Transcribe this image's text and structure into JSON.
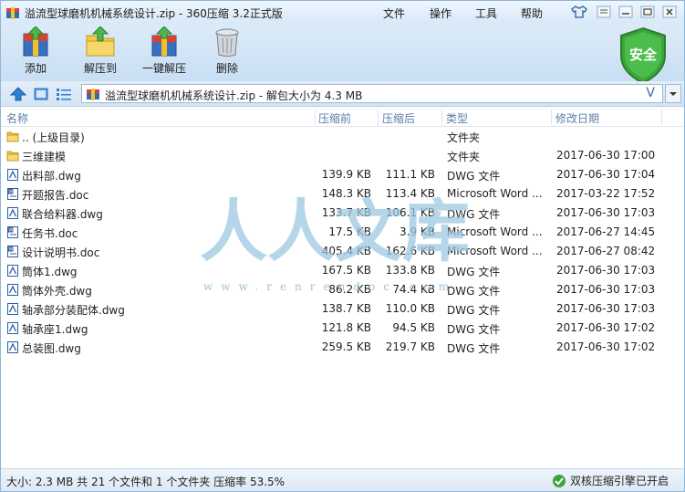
{
  "titlebar": {
    "title": "溢流型球磨机机械系统设计.zip - 360压缩 3.2正式版",
    "menus": [
      "文件",
      "操作",
      "工具",
      "帮助"
    ]
  },
  "toolbar": {
    "add_label": "添加",
    "extract_label": "解压到",
    "one_click_label": "一键解压",
    "delete_label": "删除",
    "shield_label": "安全"
  },
  "address": {
    "path": "溢流型球磨机机械系统设计.zip - 解包大小为 4.3 MB",
    "v_label": "V"
  },
  "columns": {
    "name": "名称",
    "pre": "压缩前",
    "post": "压缩后",
    "type": "类型",
    "date": "修改日期"
  },
  "files": [
    {
      "name": ".. (上级目录)",
      "pre": "",
      "post": "",
      "type": "文件夹",
      "date": "",
      "icon": "folder-icon"
    },
    {
      "name": "三维建模",
      "pre": "",
      "post": "",
      "type": "文件夹",
      "date": "2017-06-30 17:00",
      "icon": "folder-icon"
    },
    {
      "name": "出料部.dwg",
      "pre": "139.9 KB",
      "post": "111.1 KB",
      "type": "DWG 文件",
      "date": "2017-06-30 17:04",
      "icon": "dwg-icon"
    },
    {
      "name": "开题报告.doc",
      "pre": "148.3 KB",
      "post": "113.4 KB",
      "type": "Microsoft Word ...",
      "date": "2017-03-22 17:52",
      "icon": "doc-icon"
    },
    {
      "name": "联合给料器.dwg",
      "pre": "133.7 KB",
      "post": "106.1 KB",
      "type": "DWG 文件",
      "date": "2017-06-30 17:03",
      "icon": "dwg-icon"
    },
    {
      "name": "任务书.doc",
      "pre": "17.5 KB",
      "post": "3.9 KB",
      "type": "Microsoft Word ...",
      "date": "2017-06-27 14:45",
      "icon": "doc-icon"
    },
    {
      "name": "设计说明书.doc",
      "pre": "405.4 KB",
      "post": "162.6 KB",
      "type": "Microsoft Word ...",
      "date": "2017-06-27 08:42",
      "icon": "doc-icon"
    },
    {
      "name": "筒体1.dwg",
      "pre": "167.5 KB",
      "post": "133.8 KB",
      "type": "DWG 文件",
      "date": "2017-06-30 17:03",
      "icon": "dwg-icon"
    },
    {
      "name": "筒体外壳.dwg",
      "pre": "86.2 KB",
      "post": "74.4 KB",
      "type": "DWG 文件",
      "date": "2017-06-30 17:03",
      "icon": "dwg-icon"
    },
    {
      "name": "轴承部分装配体.dwg",
      "pre": "138.7 KB",
      "post": "110.0 KB",
      "type": "DWG 文件",
      "date": "2017-06-30 17:03",
      "icon": "dwg-icon"
    },
    {
      "name": "轴承座1.dwg",
      "pre": "121.8 KB",
      "post": "94.5 KB",
      "type": "DWG 文件",
      "date": "2017-06-30 17:02",
      "icon": "dwg-icon"
    },
    {
      "name": "总装图.dwg",
      "pre": "259.5 KB",
      "post": "219.7 KB",
      "type": "DWG 文件",
      "date": "2017-06-30 17:02",
      "icon": "dwg-icon"
    }
  ],
  "watermark": {
    "text": "人人文库",
    "url": "www.renrendoc.com"
  },
  "status": {
    "left": "大小: 2.3 MB 共 21 个文件和 1 个文件夹 压缩率 53.5%",
    "right": "双核压缩引擎已开启"
  },
  "colors": {
    "accent": "#3a7bc8",
    "shield": "#3aa53a",
    "header_text": "#5d7fa8"
  }
}
